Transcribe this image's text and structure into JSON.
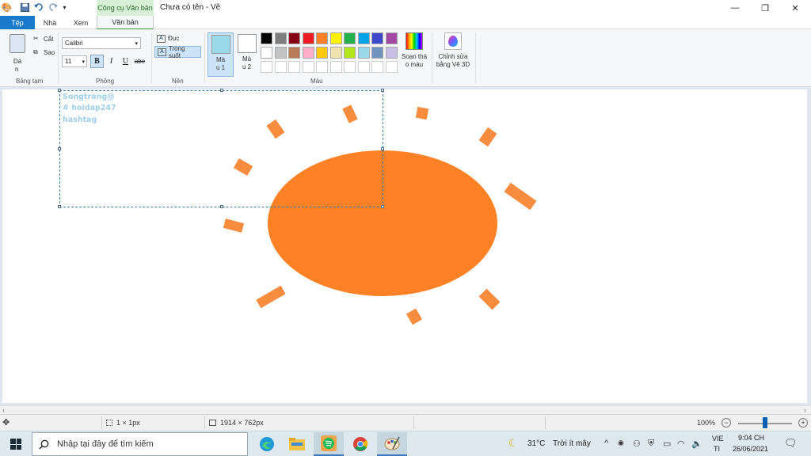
{
  "window": {
    "title": "Chưa có tên - Vẽ",
    "context_tab_header": "Công cụ Văn bản",
    "minimize_glyph": "—",
    "maximize_glyph": "❐",
    "close_glyph": "✕"
  },
  "tabs": [
    {
      "label": "Tệp"
    },
    {
      "label": "Nhà"
    },
    {
      "label": "Xem"
    },
    {
      "label": "Văn bản"
    }
  ],
  "ribbon": {
    "clipboard": {
      "paste_label_1": "Dá",
      "paste_label_2": "n",
      "cut_label": "Cắt",
      "copy_label": "Sao",
      "group_label": "Bảng tạm"
    },
    "font": {
      "family": "Calibri",
      "size": "11",
      "bold": "B",
      "italic": "I",
      "underline": "U",
      "strike": "abe",
      "group_label": "Phông"
    },
    "background": {
      "opaque_label": "Đục",
      "transparent_label": "Trong suốt",
      "group_label": "Nền"
    },
    "colors": {
      "color1_label_1": "Mà",
      "color1_label_2": "u 1",
      "color2_label_1": "Mà",
      "color2_label_2": "u 2",
      "color1": "#99d9ea",
      "color2": "#ffffff",
      "palette_row1": [
        "#000000",
        "#7f7f7f",
        "#880015",
        "#ed1c24",
        "#ff7f27",
        "#fff200",
        "#22b14c",
        "#00a2e8",
        "#3f48cc",
        "#a349a4"
      ],
      "palette_row2": [
        "#ffffff",
        "#c3c3c3",
        "#b97a57",
        "#ffaec9",
        "#ffc90e",
        "#efe4b0",
        "#b5e61d",
        "#99d9ea",
        "#7092be",
        "#c8bfe7"
      ],
      "edit_colors_label_1": "Soạn thả",
      "edit_colors_label_2": "o màu",
      "group_label": "Màu"
    },
    "paint3d": {
      "label_1": "Chỉnh sửa",
      "label_2": "bằng Vẽ 3D"
    }
  },
  "canvas": {
    "text_lines": [
      "Songtrang@",
      "# hoidap247",
      "hashtag"
    ],
    "sun_color": "#ff8125",
    "ray_color": "#f77f2a",
    "text_color": "#9fd0ea"
  },
  "status": {
    "cursor_size": "1 × 1px",
    "canvas_size": "1914 × 762px",
    "zoom": "100%",
    "zoom_level": 0.5
  },
  "taskbar": {
    "search_placeholder": "Nhập tại đây để tìm kiếm",
    "weather_temp": "31°C",
    "weather_desc": "Trời ít mây",
    "language_1": "VIE",
    "language_2": "TI",
    "time": "9:04 CH",
    "date": "26/06/2021"
  }
}
